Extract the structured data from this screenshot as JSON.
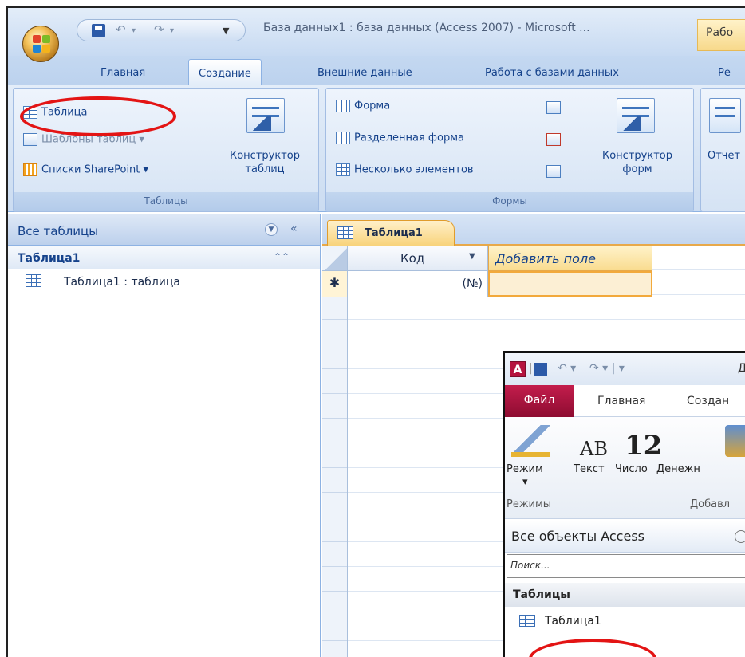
{
  "window": {
    "title": "База данных1 : база данных (Access 2007) - Microsoft ...",
    "context_tab_title": "Рабо"
  },
  "ribbon_tabs": [
    {
      "label": "Главная"
    },
    {
      "label": "Создание"
    },
    {
      "label": "Внешние данные"
    },
    {
      "label": "Работа с базами данных"
    },
    {
      "label": "Ре"
    }
  ],
  "ribbon": {
    "tables_group": {
      "label": "Таблицы",
      "table_button": "Таблица",
      "templates_button": "Шаблоны таблиц",
      "sharepoint_button": "Списки SharePoint",
      "designer_button_line1": "Конструктор",
      "designer_button_line2": "таблиц"
    },
    "forms_group": {
      "label": "Формы",
      "form_button": "Форма",
      "split_form_button": "Разделенная форма",
      "multiple_items_button": "Несколько элементов",
      "designer_button_line1": "Конструктор",
      "designer_button_line2": "форм"
    },
    "reports_group": {
      "report_button": "Отчет"
    }
  },
  "nav_pane": {
    "header": "Все таблицы",
    "group": "Таблица1",
    "item": "Таблица1 : таблица"
  },
  "document": {
    "tab_label": "Таблица1",
    "column_id": "Код",
    "column_add": "Добавить поле",
    "new_row_marker": "✱",
    "new_row_value": "(№)"
  },
  "inset": {
    "logo_letter": "A",
    "title_fragment": "Д",
    "tabs": [
      {
        "label": "Файл"
      },
      {
        "label": "Главная"
      },
      {
        "label": "Создан"
      }
    ],
    "ribbon_items": [
      {
        "label": "Режим"
      },
      {
        "label": "Текст"
      },
      {
        "label": "Число"
      },
      {
        "label": "Денежн"
      }
    ],
    "text_icon_glyph": "AB",
    "number_icon_glyph": "12",
    "group_modes": "Режимы",
    "group_add": "Добавл",
    "nav_header": "Все объекты Access",
    "search_placeholder": "Поиск...",
    "category": "Таблицы",
    "item": "Таблица1"
  },
  "colors": {
    "highlight": "#e31414",
    "ribbon_text": "#15428b",
    "access_brand": "#b5133e"
  }
}
